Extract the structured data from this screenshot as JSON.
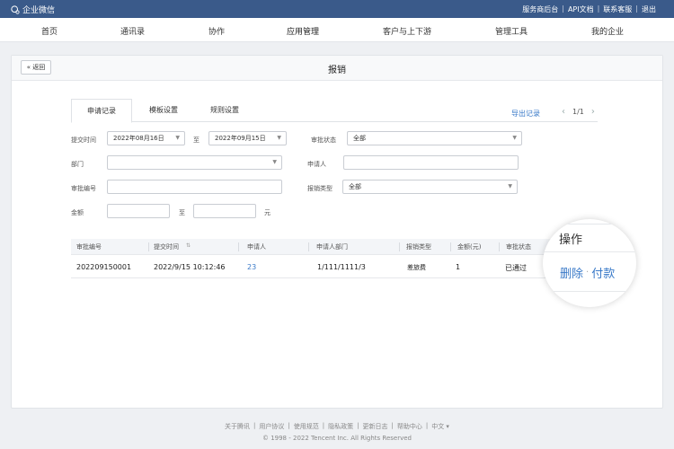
{
  "topbar": {
    "brand": "企业微信",
    "links": [
      "服务商后台",
      "API文档",
      "联系客服",
      "退出"
    ]
  },
  "nav": {
    "items": [
      "首页",
      "通讯录",
      "协作",
      "应用管理",
      "客户与上下游",
      "管理工具",
      "我的企业"
    ],
    "active": "应用管理"
  },
  "card": {
    "back": "返回",
    "title": "报销"
  },
  "tabs": {
    "items": [
      "申请记录",
      "模板设置",
      "规则设置"
    ],
    "active": "申请记录",
    "export": "导出记录",
    "pager": "1/1"
  },
  "filters": {
    "submit_time_label": "提交时间",
    "date_from": "2022年08月16日",
    "to": "至",
    "date_to": "2022年09月15日",
    "approval_status_label": "审批状态",
    "approval_status_value": "全部",
    "department_label": "部门",
    "department_value": "",
    "applicant_label": "申请人",
    "applicant_value": "",
    "approval_no_label": "审批编号",
    "approval_no_value": "",
    "reimburse_type_label": "报销类型",
    "reimburse_type_value": "全部",
    "amount_label": "金额",
    "amount_from": "",
    "amount_to_label": "至",
    "amount_to": "",
    "currency": "元"
  },
  "table": {
    "headers": [
      "审批编号",
      "提交时间",
      "申请人",
      "申请人部门",
      "报销类型",
      "金额(元)",
      "审批状态"
    ],
    "rows": [
      {
        "approval_no": "202209150001",
        "submit_time": "2022/9/15 10:12:46",
        "applicant": "23",
        "department": "1/111/1111/3",
        "type": "差旅费",
        "amount": "1",
        "status": "已通过"
      }
    ]
  },
  "magnifier": {
    "header": "操作",
    "delete": "删除",
    "pay": "付款"
  },
  "footer": {
    "links": [
      "关于腾讯",
      "用户协议",
      "使用规范",
      "隐私政策",
      "更新日志",
      "帮助中心",
      "中文 ▾"
    ],
    "copyright": "© 1998 - 2022 Tencent Inc. All Rights Reserved"
  },
  "colors": {
    "topbar": "#3a5a8a",
    "link": "#3a7ac8"
  }
}
